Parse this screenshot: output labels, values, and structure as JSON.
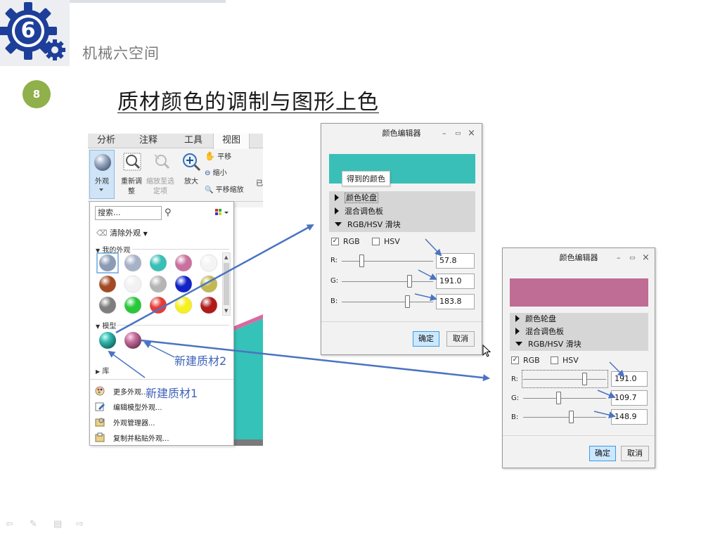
{
  "brand": "机械六空间",
  "slide": {
    "number": "8",
    "title": "质材颜色的调制与图形上色",
    "logo_digit": "6"
  },
  "ribbon": {
    "tabs": [
      "分析",
      "注释",
      "工具",
      "视图"
    ],
    "active_tab": "视图",
    "appearance_label": "外观",
    "refit_label_1": "重新调",
    "refit_label_2": "整",
    "zoom_selected_label_1": "缩放至选",
    "zoom_selected_label_2": "定项",
    "zoom_in_label": "放大",
    "pan_label": "平移",
    "zoom_out_label": "缩小",
    "pan_zoom_label": "平移缩放",
    "cut_label": "已"
  },
  "gallery": {
    "search_placeholder": "搜索...",
    "clear_appearance": "清除外观",
    "my_appearances": "我的外观",
    "model_section": "模型",
    "library_section": "库",
    "menu": [
      "更多外观...",
      "编辑模型外观...",
      "外观管理器...",
      "复制并粘贴外观..."
    ],
    "swatch_colors": [
      [
        "#8b9bb6",
        "#a7b2c8",
        "#38bfb6",
        "#c9719e",
        "#f4f4f4"
      ],
      [
        "#a34a22",
        "#f2f2f2",
        "#b5b5b5",
        "#1022c8",
        "#c2b852"
      ],
      [
        "#7e7e7e",
        "#27c83a",
        "#e83a35",
        "#f5f020",
        "#b01a1a"
      ]
    ],
    "model_swatches": [
      "#33b8ad",
      "#c36f9b"
    ]
  },
  "dialog1": {
    "title": "颜色编辑器",
    "tooltip": "得到的颜色",
    "preview_color": "#39bfb8",
    "sections": [
      "颜色轮盘",
      "混合调色板",
      "RGB/HSV 滑块"
    ],
    "rgb_label": "RGB",
    "hsv_label": "HSV",
    "rgb_checked": true,
    "hsv_checked": false,
    "channels": [
      {
        "label": "R:",
        "value": "57.8"
      },
      {
        "label": "G:",
        "value": "191.0"
      },
      {
        "label": "B:",
        "value": "183.8"
      }
    ],
    "ok": "确定",
    "cancel": "取消"
  },
  "dialog2": {
    "title": "颜色编辑器",
    "preview_color": "#bf6d94",
    "sections": [
      "颜色轮盘",
      "混合调色板",
      "RGB/HSV 滑块"
    ],
    "rgb_label": "RGB",
    "hsv_label": "HSV",
    "rgb_checked": true,
    "hsv_checked": false,
    "channels": [
      {
        "label": "R:",
        "value": "191.0"
      },
      {
        "label": "G:",
        "value": "109.7"
      },
      {
        "label": "B:",
        "value": "148.9"
      }
    ],
    "ok": "确定",
    "cancel": "取消"
  },
  "annotations": {
    "new_material_1": "新建质材1",
    "new_material_2": "新建质材2"
  },
  "colors": {
    "accent_arrow": "#4a74c2",
    "slide_badge": "#8fb04a",
    "logo_blue": "#1d3f9a"
  }
}
